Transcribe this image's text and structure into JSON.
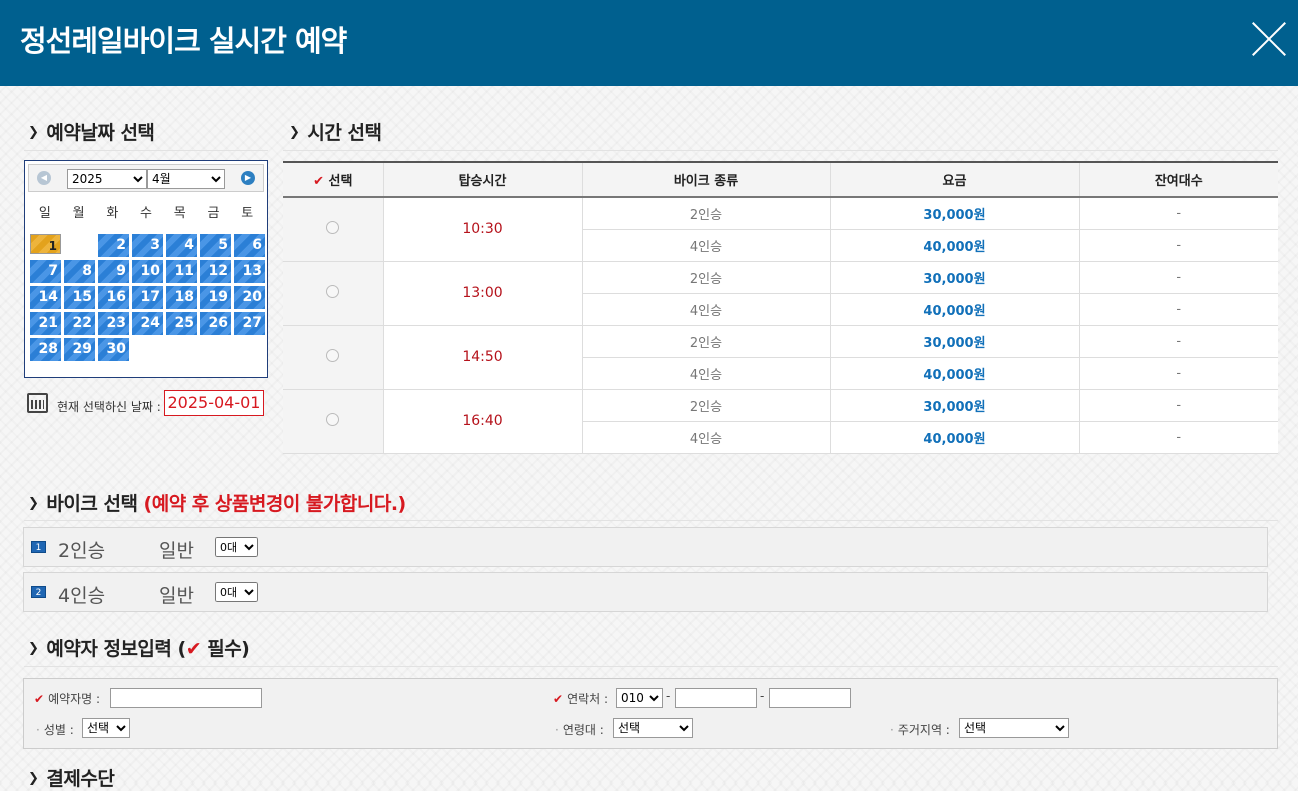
{
  "header": {
    "title": "정선레일바이크 실시간 예약"
  },
  "date_section": {
    "title": "예약날짜 선택"
  },
  "calendar": {
    "year": "2025",
    "month": "4월",
    "weekdays": [
      "일",
      "월",
      "화",
      "수",
      "목",
      "금",
      "토"
    ],
    "days": [
      "1",
      "2",
      "3",
      "4",
      "5",
      "6",
      "7",
      "8",
      "9",
      "10",
      "11",
      "12",
      "13",
      "14",
      "15",
      "16",
      "17",
      "18",
      "19",
      "20",
      "21",
      "22",
      "23",
      "24",
      "25",
      "26",
      "27",
      "28",
      "29",
      "30"
    ],
    "selected_day": "1",
    "current_label": "현재 선택하신 날짜 :",
    "current_value": "2025-04-01"
  },
  "time_section": {
    "title": "시간 선택"
  },
  "time_table": {
    "headers": [
      "선택",
      "탑승시간",
      "바이크 종류",
      "요금",
      "잔여대수"
    ],
    "check_mark": "✔",
    "rows": [
      {
        "time": "10:30",
        "a_type": "2인승",
        "a_price": "30,000원",
        "a_remain": "-",
        "b_type": "4인승",
        "b_price": "40,000원",
        "b_remain": "-"
      },
      {
        "time": "13:00",
        "a_type": "2인승",
        "a_price": "30,000원",
        "a_remain": "-",
        "b_type": "4인승",
        "b_price": "40,000원",
        "b_remain": "-"
      },
      {
        "time": "14:50",
        "a_type": "2인승",
        "a_price": "30,000원",
        "a_remain": "-",
        "b_type": "4인승",
        "b_price": "40,000원",
        "b_remain": "-"
      },
      {
        "time": "16:40",
        "a_type": "2인승",
        "a_price": "30,000원",
        "a_remain": "-",
        "b_type": "4인승",
        "b_price": "40,000원",
        "b_remain": "-"
      }
    ]
  },
  "bike_section": {
    "title": "바이크 선택",
    "warning": "(예약 후 상품변경이 불가합니다.)"
  },
  "bikes": [
    {
      "num": "1",
      "name": "2인승",
      "type": "일반",
      "qty": "0대"
    },
    {
      "num": "2",
      "name": "4인승",
      "type": "일반",
      "qty": "0대"
    }
  ],
  "info_section": {
    "title_prefix": "예약자 정보입력 (",
    "check_mark": "✔",
    "title_suffix": " 필수)"
  },
  "form": {
    "name_label": "예약자명 :",
    "phone_label": "연락처 :",
    "phone_prefix": "010",
    "dash": "-",
    "gender_label": "성별 :",
    "gender_value": "선택",
    "age_label": "연령대 :",
    "age_value": "선택",
    "region_label": "주거지역 :",
    "region_value": "선택"
  },
  "payment_section": {
    "title": "결제수단"
  }
}
